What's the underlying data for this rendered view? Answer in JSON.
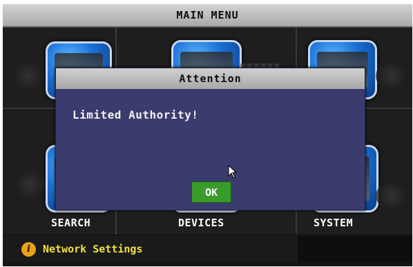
{
  "main_menu": {
    "title": "MAIN MENU"
  },
  "tiles": [
    {
      "label": "SEARCH",
      "icon": "search-tile-icon"
    },
    {
      "label": "DEVICES",
      "icon": "devices-tile-icon"
    },
    {
      "label": "SYSTEM",
      "icon": "system-tile-icon"
    }
  ],
  "status_bar": {
    "icon": "info-icon",
    "text": "Network Settings"
  },
  "dialog": {
    "title": "Attention",
    "message": "Limited Authority!",
    "ok_label": "OK"
  },
  "colors": {
    "dialog_background": "#3a3c6e",
    "ok_button": "#3a9a2a",
    "status_text": "#f0e040",
    "info_icon": "#e8a317"
  }
}
